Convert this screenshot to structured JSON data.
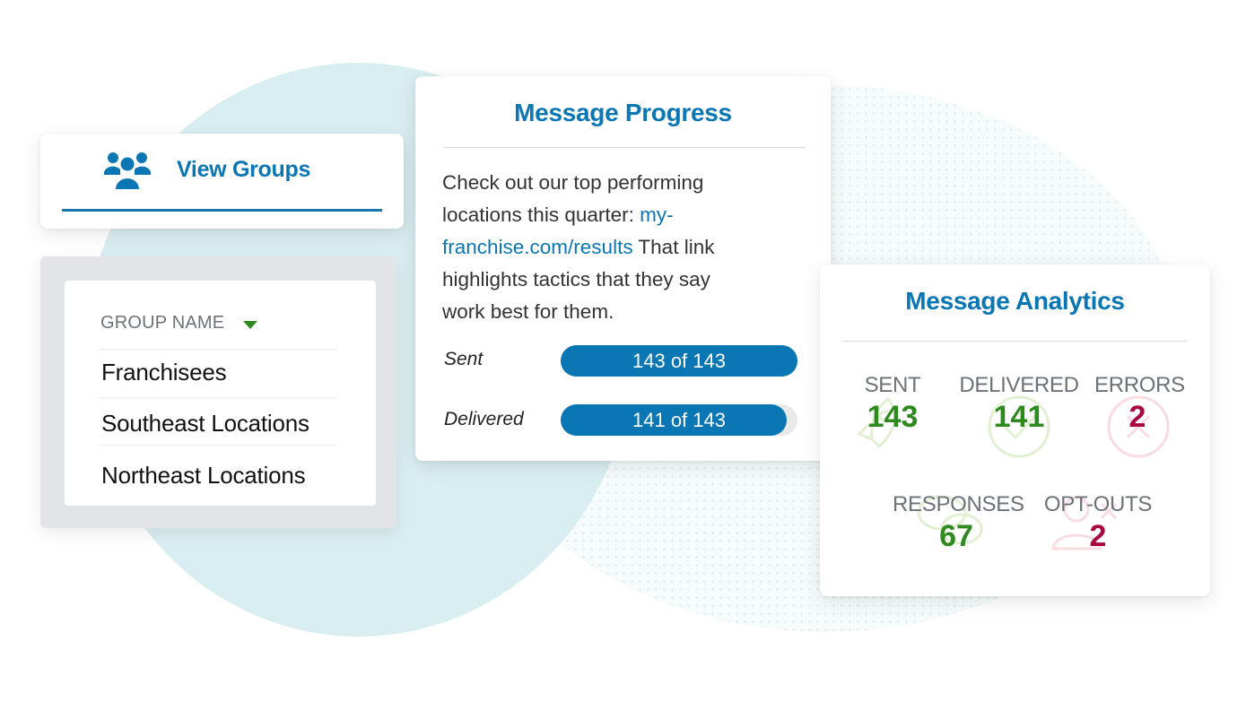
{
  "colors": {
    "brand_blue": "#0a76b3",
    "success_green": "#2e8a1e",
    "error_red": "#a8073f",
    "label_gray": "#6d7178"
  },
  "view_groups": {
    "icon": "users-icon",
    "label": "View Groups"
  },
  "group_list": {
    "header": "GROUP NAME",
    "sort_icon": "caret-down-icon",
    "rows": [
      "Franchisees",
      "Southeast Locations",
      "Northeast Locations"
    ]
  },
  "message_progress": {
    "title": "Message Progress",
    "body_text_1": "Check out our top performing locations this quarter: ",
    "body_link": "my-franchise.com/results",
    "body_text_2": " That link highlights tactics that they say work best for them.",
    "bars": [
      {
        "label": "Sent",
        "text": "143 of 143",
        "current": 143,
        "total": 143
      },
      {
        "label": "Delivered",
        "text": "141 of 143",
        "current": 141,
        "total": 143
      }
    ]
  },
  "message_analytics": {
    "title": "Message Analytics",
    "stats": [
      {
        "label": "SENT",
        "value": "143",
        "status": "success",
        "icon": "rocket-icon"
      },
      {
        "label": "DELIVERED",
        "value": "141",
        "status": "success",
        "icon": "check-circle-icon"
      },
      {
        "label": "ERRORS",
        "value": "2",
        "status": "error",
        "icon": "x-circle-icon"
      },
      {
        "label": "RESPONSES",
        "value": "67",
        "status": "success",
        "icon": "chat-bubbles-icon"
      },
      {
        "label": "OPT-OUTS",
        "value": "2",
        "status": "error",
        "icon": "user-remove-icon"
      }
    ]
  }
}
